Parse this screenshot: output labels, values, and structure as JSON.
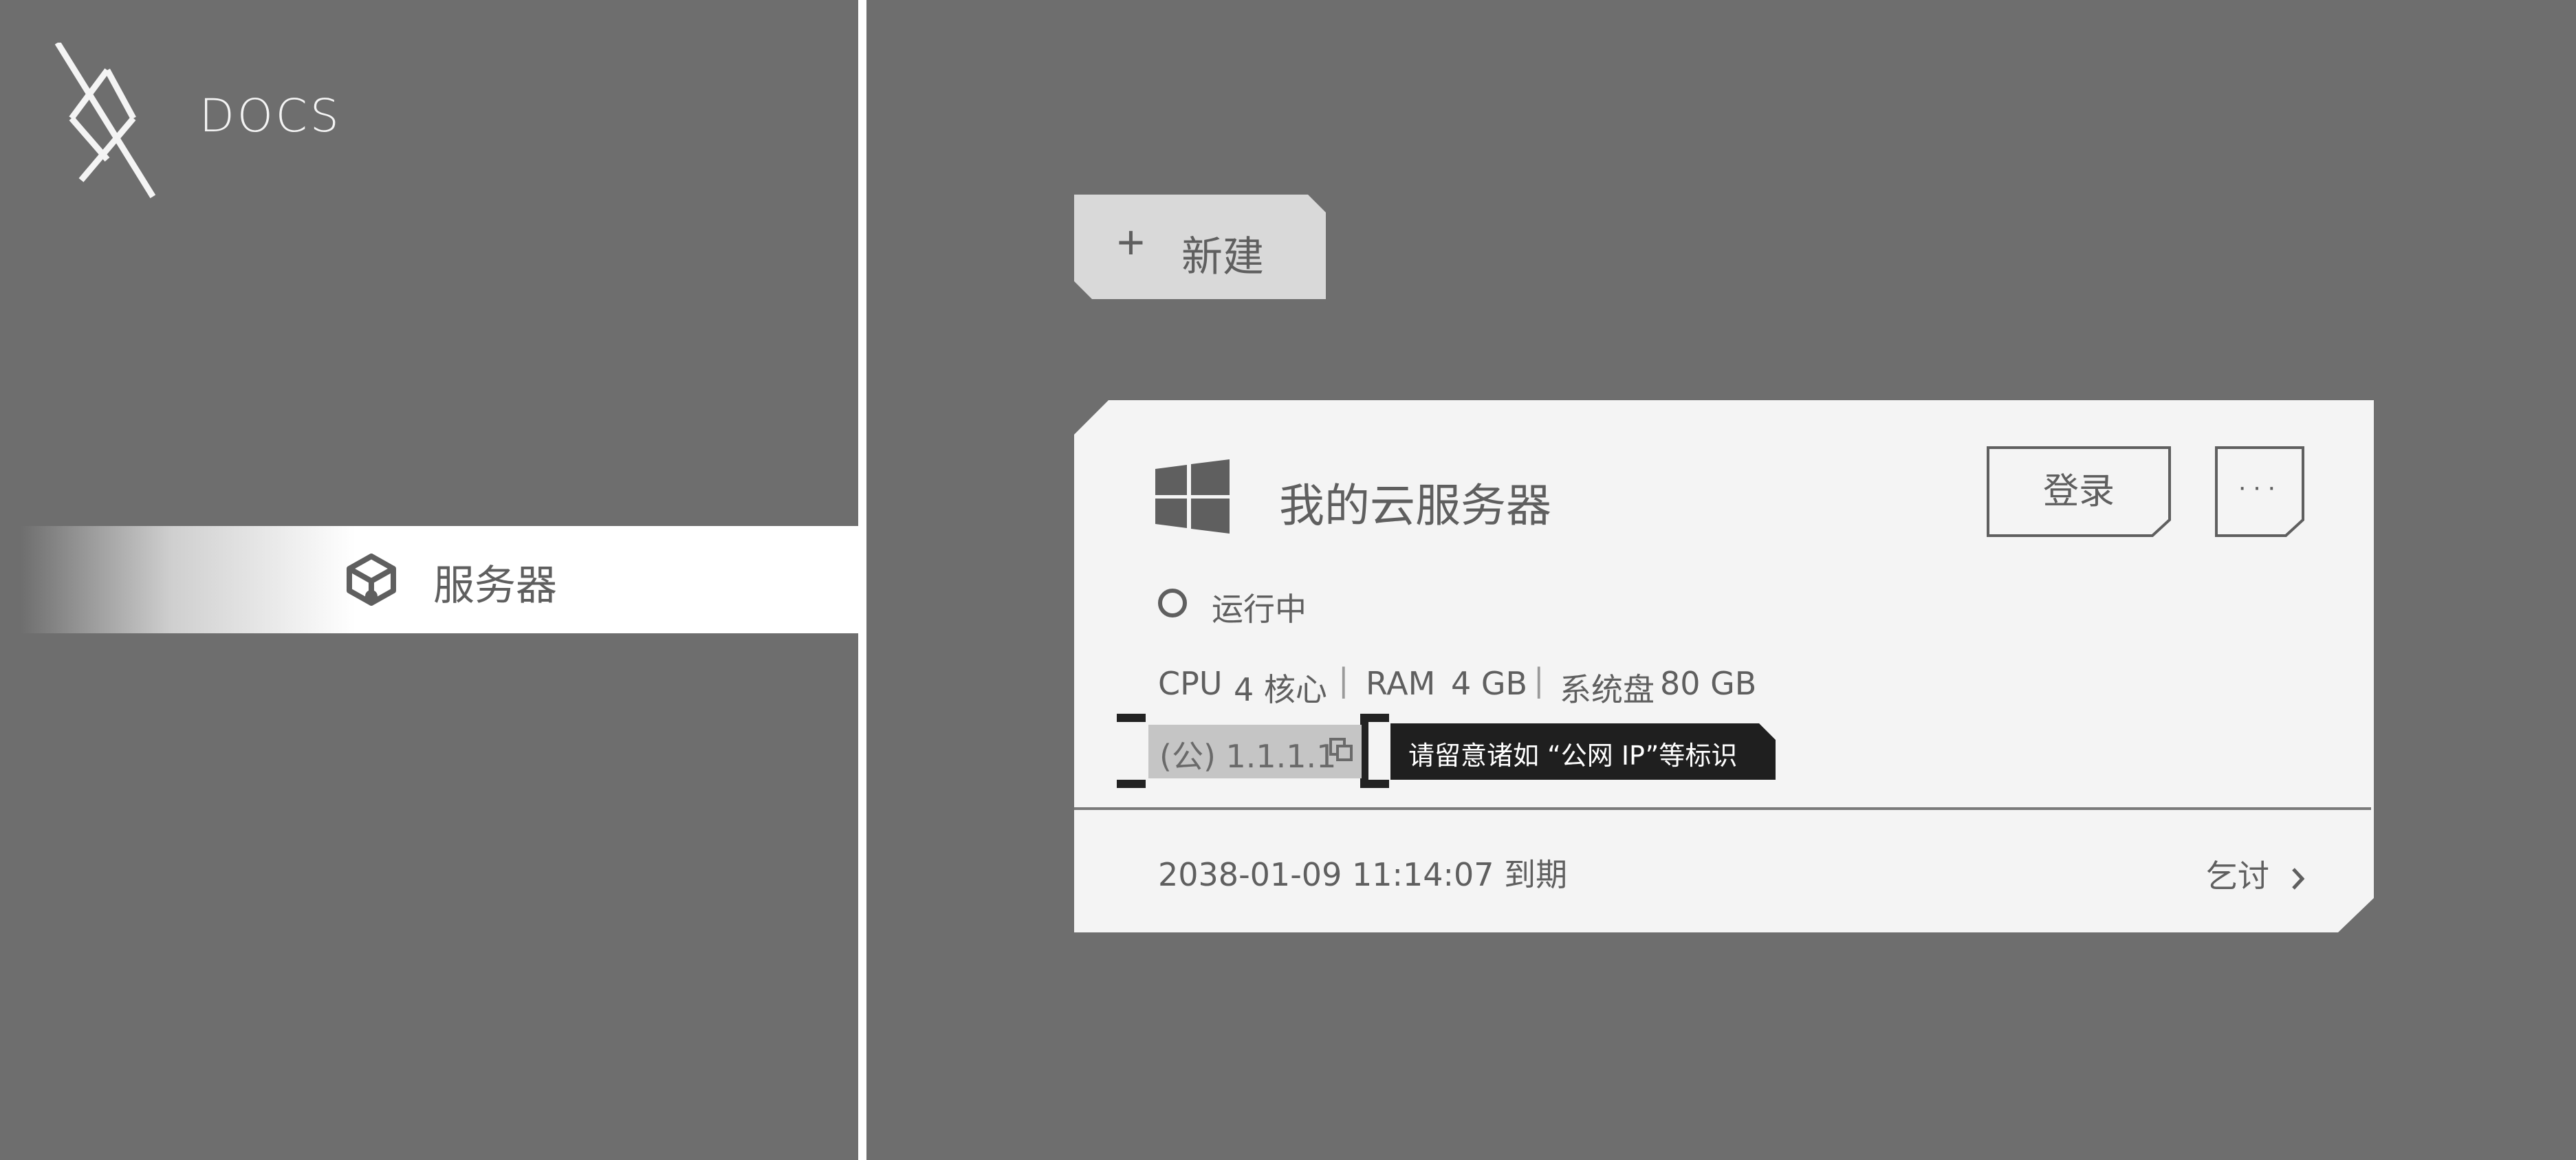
{
  "sidebar": {
    "brand": "DOCS",
    "nav_items": [
      {
        "label": "服务器",
        "icon": "server-box-icon",
        "active": true
      }
    ]
  },
  "toolbar": {
    "new_icon": "plus-icon",
    "new_label": "新建"
  },
  "server_card": {
    "os_icon": "windows-icon",
    "title": "我的云服务器",
    "login_label": "登录",
    "more_label": "···",
    "status": "运行中",
    "specs": {
      "cpu_label": "CPU",
      "cpu_value": "4 核心",
      "ram_label": "RAM",
      "ram_value": "4 GB",
      "disk_label": "系统盘",
      "disk_value": "80 GB"
    },
    "ip_label": "(公) 1.1.1.1",
    "copy_icon": "copy-icon",
    "hint": "请留意诸如 “公网 IP”等标识",
    "expiry": "2038-01-09 11:14:07  到期",
    "renew_label": "乞讨"
  },
  "colors": {
    "background": "#6e6e6e",
    "card": "#f4f4f4",
    "text": "#5f5f5f",
    "hint_bg": "#1f1f1f"
  }
}
